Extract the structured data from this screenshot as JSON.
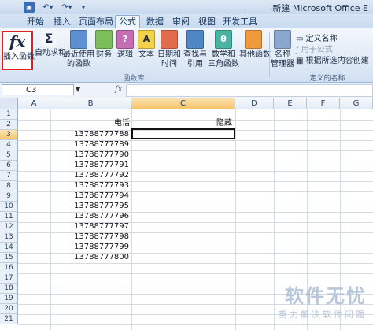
{
  "window": {
    "title": "新建 Microsoft Office E"
  },
  "quick_access": {
    "save_icon": "save-icon",
    "undo_icon": "undo-icon",
    "redo_icon": "redo-icon"
  },
  "tabs": [
    {
      "label": "开始"
    },
    {
      "label": "插入"
    },
    {
      "label": "页面布局"
    },
    {
      "label": "公式"
    },
    {
      "label": "数据"
    },
    {
      "label": "审阅"
    },
    {
      "label": "视图"
    },
    {
      "label": "开发工具"
    }
  ],
  "ribbon": {
    "insert_function": {
      "line1": "插入函数",
      "icon": "fx-icon"
    },
    "autosum": {
      "label": "自动求和"
    },
    "recent": {
      "line1": "最近使用",
      "line2": "的函数"
    },
    "financial": {
      "label": "财务"
    },
    "logical": {
      "label": "逻辑"
    },
    "text": {
      "label": "文本"
    },
    "datetime": {
      "line1": "日期和",
      "line2": "时间"
    },
    "lookup": {
      "line1": "查找与",
      "line2": "引用"
    },
    "math": {
      "line1": "数学和",
      "line2": "三角函数"
    },
    "other": {
      "label": "其他函数"
    },
    "name_manager": {
      "line1": "名称",
      "line2": "管理器"
    },
    "define_name": "定义名称",
    "use_in_formula": "用于公式",
    "create_from_selection": "根据所选内容创建",
    "group_library": "函数库",
    "group_names": "定义的名称"
  },
  "formula_bar": {
    "name_box": "C3",
    "fx": "fx",
    "formula": ""
  },
  "columns": [
    "A",
    "B",
    "C",
    "D",
    "E",
    "F",
    "G"
  ],
  "rows": [
    "1",
    "2",
    "3",
    "4",
    "5",
    "6",
    "7",
    "8",
    "9",
    "10",
    "11",
    "12",
    "13",
    "14",
    "15",
    "16",
    "17",
    "18",
    "19",
    "20",
    "21"
  ],
  "cells": {
    "B2": "电话",
    "C2": "隐藏",
    "B_values": [
      "13788777788",
      "13788777789",
      "13788777790",
      "13788777791",
      "13788777792",
      "13788777793",
      "13788777794",
      "13788777795",
      "13788777796",
      "13788777797",
      "13788777798",
      "13788777799",
      "13788777800"
    ]
  },
  "watermark": {
    "main": "软件无忧",
    "sub": "努力解决软件问题"
  }
}
